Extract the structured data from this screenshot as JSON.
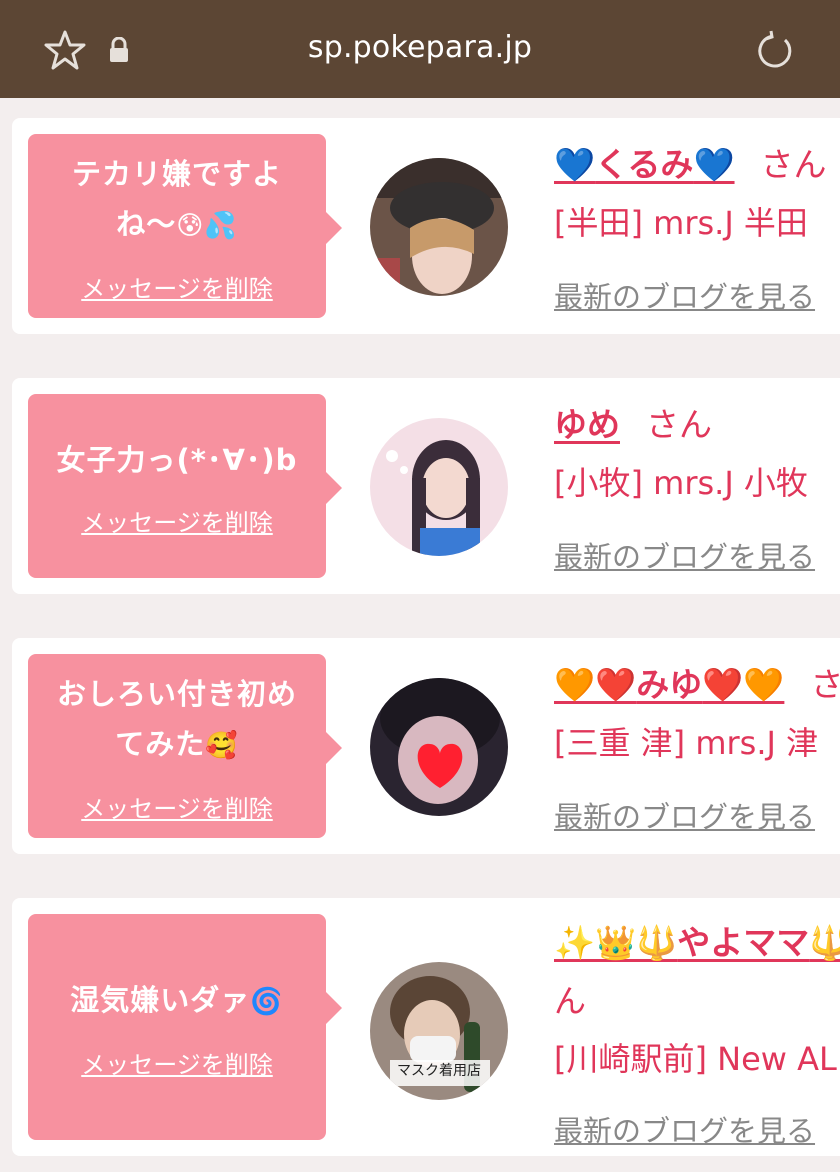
{
  "browser": {
    "url": "sp.pokepara.jp",
    "icons": [
      "star-icon",
      "lock-icon",
      "reload-icon"
    ]
  },
  "colors": {
    "topbar": "#5c4634",
    "bubble": "#f7919f",
    "accent": "#e0365a",
    "link_gray": "#888888"
  },
  "cards": [
    {
      "message_line1": "テカリ嫌ですよ",
      "message_line2": "ね〜",
      "message_emoji": "😰💦",
      "delete_label": "メッセージを削除",
      "name_prefix": "💙",
      "name": "くるみ",
      "name_suffix": "💙",
      "san": "さん",
      "shop": "[半田] mrs.J 半田",
      "blog_link": "最新のブログを見る"
    },
    {
      "message_line1": "女子力っ(*･∀･)b",
      "delete_label": "メッセージを削除",
      "name": "ゆめ",
      "san": "さん",
      "shop": "[小牧] mrs.J 小牧",
      "blog_link": "最新のブログを見る"
    },
    {
      "message_line1": "おしろい付き初め",
      "message_line2": "てみた",
      "message_emoji": "🥰",
      "delete_label": "メッセージを削除",
      "name_prefix": "🧡❤️",
      "name": "みゆ",
      "name_suffix": "❤️🧡",
      "san": "さん",
      "shop": "[三重 津] mrs.J 津",
      "blog_link": "最新のブログを見る"
    },
    {
      "message_line1": "湿気嫌いダァ",
      "message_emoji": "🌀",
      "delete_label": "メッセージを削除",
      "name_prefix": "✨👑🔱",
      "name": "やよママ",
      "name_suffix": "🔱",
      "san_wrap": "ん",
      "shop": "[川崎駅前] New AL",
      "blog_link": "最新のブログを見る",
      "avatar_caption": "マスク着用店"
    }
  ]
}
